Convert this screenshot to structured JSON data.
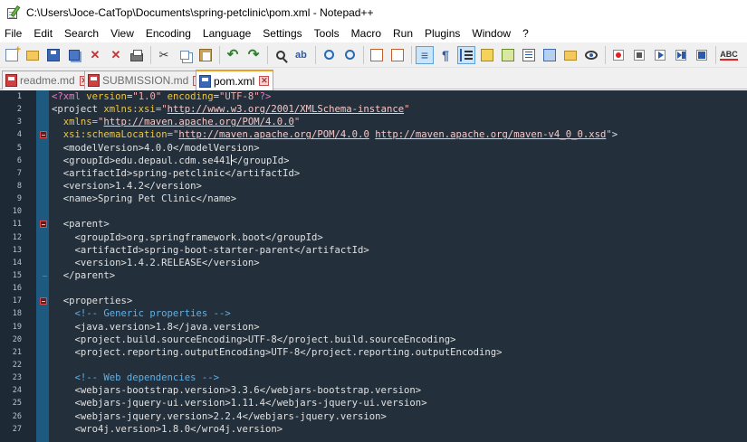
{
  "window": {
    "title": "C:\\Users\\Joce-CatTop\\Documents\\spring-petclinic\\pom.xml - Notepad++"
  },
  "menu": [
    "File",
    "Edit",
    "Search",
    "View",
    "Encoding",
    "Language",
    "Settings",
    "Tools",
    "Macro",
    "Run",
    "Plugins",
    "Window",
    "?"
  ],
  "toolbar": {
    "spellcheck_label": "ABC"
  },
  "tabs": [
    {
      "label": "readme.md",
      "icon": "red-doc-icon",
      "active": false
    },
    {
      "label": "SUBMISSION.md",
      "icon": "red-doc-icon",
      "active": false
    },
    {
      "label": "pom.xml",
      "icon": "blue-doc-icon",
      "active": true
    }
  ],
  "editor": {
    "colors": {
      "background": "#232f3a",
      "gutter": "#1d2935",
      "fold_margin": "#1e5a80",
      "tag": "#e0e0e0",
      "attribute": "#efc640",
      "value": "#f0b0b0",
      "comment": "#5fb0e8",
      "declaration": "#e879c6"
    },
    "line_numbers": [
      "1",
      "2",
      "3",
      "4",
      "5",
      "6",
      "7",
      "8",
      "9",
      "10",
      "11",
      "12",
      "13",
      "14",
      "15",
      "16",
      "17",
      "18",
      "19",
      "20",
      "21",
      "22",
      "23",
      "24",
      "25",
      "26",
      "27"
    ],
    "lines": {
      "l1_a": "<?xml ",
      "l1_b": "version",
      "l1_c": "=",
      "l1_d": "\"1.0\"",
      "l1_e": " encoding",
      "l1_f": "=",
      "l1_g": "\"UTF-8\"",
      "l1_h": "?>",
      "l2_a": "<project ",
      "l2_b": "xmlns:xsi",
      "l2_c": "=\"",
      "l2_d": "http://www.w3.org/2001/XMLSchema-instance",
      "l2_e": "\"",
      "l3_a": "  ",
      "l3_b": "xmlns",
      "l3_c": "=\"",
      "l3_d": "http://maven.apache.org/POM/4.0.0",
      "l3_e": "\"",
      "l4_a": "  ",
      "l4_b": "xsi:schemaLocation",
      "l4_c": "=\"",
      "l4_d": "http://maven.apache.org/POM/4.0.0",
      "l4_e": " ",
      "l4_f": "http://maven.apache.org/maven-v4_0_0.xsd",
      "l4_g": "\"",
      "l4_h": ">",
      "l5": "  <modelVersion>4.0.0</modelVersion>",
      "l6_a": "  <groupId>edu.depaul.cdm.se441",
      "l6_b": "</groupId>",
      "l7": "  <artifactId>spring-petclinic</artifactId>",
      "l8": "  <version>1.4.2</version>",
      "l9": "  <name>Spring Pet Clinic</name>",
      "l10": "",
      "l11": "  <parent>",
      "l12": "    <groupId>org.springframework.boot</groupId>",
      "l13": "    <artifactId>spring-boot-starter-parent</artifactId>",
      "l14": "    <version>1.4.2.RELEASE</version>",
      "l15": "  </parent>",
      "l16": "",
      "l17": "  <properties>",
      "l18": "    <!-- Generic properties -->",
      "l19": "    <java.version>1.8</java.version>",
      "l20": "    <project.build.sourceEncoding>UTF-8</project.build.sourceEncoding>",
      "l21": "    <project.reporting.outputEncoding>UTF-8</project.reporting.outputEncoding>",
      "l22": "",
      "l23": "    <!-- Web dependencies -->",
      "l24": "    <webjars-bootstrap.version>3.3.6</webjars-bootstrap.version>",
      "l25": "    <webjars-jquery-ui.version>1.11.4</webjars-jquery-ui.version>",
      "l26": "    <webjars-jquery.version>2.2.4</webjars-jquery.version>",
      "l27": "    <wro4j.version>1.8.0</wro4j.version>"
    }
  }
}
